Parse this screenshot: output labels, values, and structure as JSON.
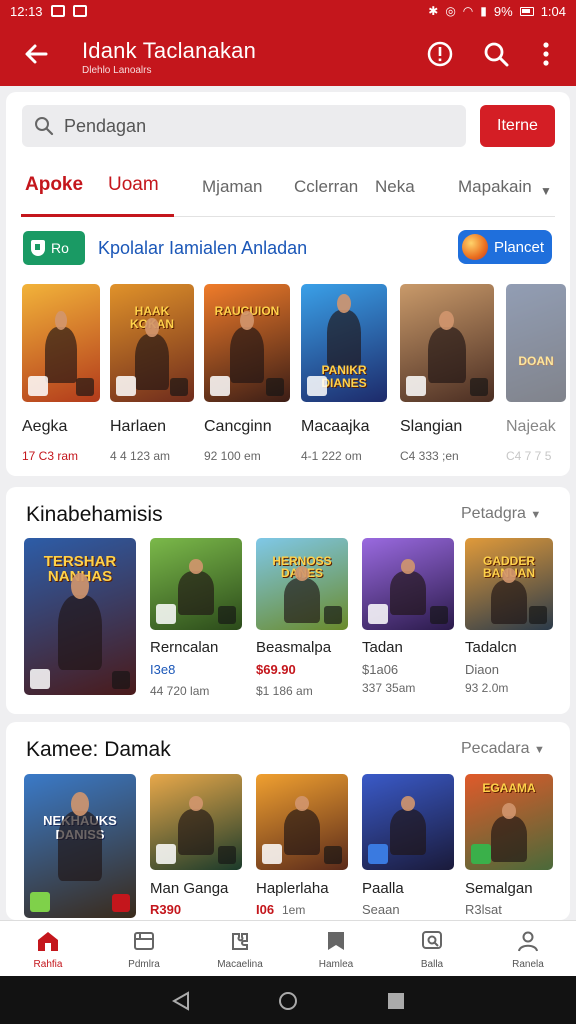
{
  "status_bar": {
    "time": "12:13",
    "battery_pct": "9%",
    "clock_right": "1:04"
  },
  "app_bar": {
    "title": "Idank Taclanakan",
    "subtitle": "Dlehlo Lanoalrs"
  },
  "search": {
    "placeholder": "Pendagan",
    "button_label": "Iterne"
  },
  "tabs": [
    "Apoke",
    "Uoam",
    "Mjaman",
    "Cclerran",
    "Neka",
    "Mapakain"
  ],
  "promo": {
    "left_label": "Ro",
    "text": "Kpolalar Iamialen Anladan",
    "right_label": "Plancet"
  },
  "featured": [
    {
      "name": "Aegka",
      "meta": "17 C3 ram",
      "meta_color": "#c4161c",
      "colors": [
        "#f2b33a",
        "#b23a1b"
      ]
    },
    {
      "name": "Harlaen",
      "meta": "4 4 123 am",
      "meta_color": "#666666",
      "colors": [
        "#e0922a",
        "#6e2b1c"
      ],
      "label": "HAAK KOKAN"
    },
    {
      "name": "Cancginn",
      "meta": "92 100 em",
      "meta_color": "#666666",
      "colors": [
        "#f07c2a",
        "#3b1d16"
      ],
      "label": "RAUCUION"
    },
    {
      "name": "Macaajka",
      "meta": "4-1 222 om",
      "meta_color": "#666666",
      "colors": [
        "#3aa0e8",
        "#1d2a6a"
      ],
      "label": "PANIKR DIANES"
    },
    {
      "name": "Slangian",
      "meta": "C4 333 ;en",
      "meta_color": "#666666",
      "colors": [
        "#c99a6a",
        "#4a2d22"
      ]
    },
    {
      "name": "Najeak",
      "meta": "C4 7 7 5",
      "meta_color": "#999999",
      "colors": [
        "#3a4f78",
        "#1a1f2e"
      ],
      "label": "DOAN"
    }
  ],
  "section1": {
    "title": "Kinabehamisis",
    "more": "Petadgra",
    "big": {
      "label": "TERSHAR NANHAS",
      "colors": [
        "#2d5da8",
        "#4a1a1a"
      ]
    },
    "items": [
      {
        "name": "Rerncalan",
        "price": "I3e8",
        "price_color": "#1b57b8",
        "meta": "44 720 lam",
        "colors": [
          "#7bb94a",
          "#2b4a1a"
        ]
      },
      {
        "name": "Beasmalpa",
        "price": "$69.90",
        "price_color": "#c4161c",
        "meta": "$1 186 am",
        "colors": [
          "#7fc8e8",
          "#6a8a2a"
        ],
        "label": "HERNOSS DANES"
      },
      {
        "name": "Tadan",
        "price": "$1a06",
        "price_color": "#666666",
        "meta": "337 35am",
        "colors": [
          "#9a6ae0",
          "#2a1a4a"
        ]
      },
      {
        "name": "Tadalcn",
        "price": "Diaon",
        "price_color": "#666666",
        "meta": "93 2.0m",
        "colors": [
          "#e09a3a",
          "#2a3a4a"
        ],
        "label": "GADDER BANUAN"
      }
    ]
  },
  "section2": {
    "title": "Kamee: Damak",
    "more": "Pecadara",
    "big": {
      "label": "NEKHAUKS DANISS",
      "colors": [
        "#3a7ac8",
        "#3a2a1a"
      ]
    },
    "items": [
      {
        "name": "Man Ganga",
        "price": "R390",
        "price_color": "#c4161c",
        "meta": "",
        "colors": [
          "#e8a84a",
          "#1a3a2a"
        ]
      },
      {
        "name": "Haplerlaha",
        "price": "I06",
        "price_color": "#c4161c",
        "meta_inline": "1em",
        "colors": [
          "#f0a030",
          "#5a2a1a"
        ]
      },
      {
        "name": "Paalla",
        "price": "Seaan",
        "price_color": "#666666",
        "meta": "",
        "colors": [
          "#3a5ac8",
          "#1a1a3a"
        ]
      },
      {
        "name": "Semalgan",
        "price": "R3lsat",
        "price_color": "#666666",
        "meta": "",
        "colors": [
          "#e05a2a",
          "#4a6a3a"
        ],
        "label": "EGAAMA"
      }
    ]
  },
  "bottom_nav": [
    "Rahfia",
    "Pdmlra",
    "Macaelina",
    "Hamlea",
    "Balla",
    "Ranela"
  ],
  "accent": "#c4161c"
}
